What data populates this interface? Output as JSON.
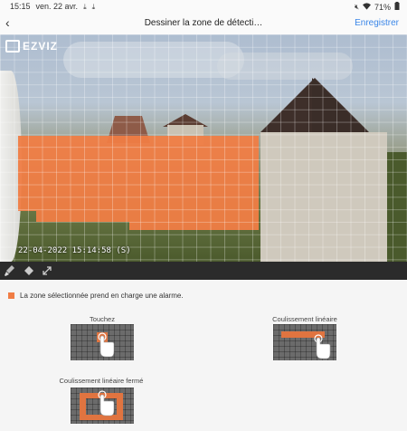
{
  "status_bar": {
    "time": "15:15",
    "date": "ven. 22 avr.",
    "battery": "71%",
    "icons": [
      "download-icon",
      "download-icon",
      "mute-icon",
      "wifi-icon",
      "battery-icon"
    ]
  },
  "header": {
    "back_icon": "chevron-left-icon",
    "title": "Dessiner la zone de détecti…",
    "save_label": "Enregistrer"
  },
  "camera": {
    "logo_text": "EZVIZ",
    "timestamp": "22-04-2022 15:14:58  (S)",
    "zone_color": "#f07d45"
  },
  "toolbar": {
    "tools": [
      "brush-icon",
      "eraser-icon",
      "fullscreen-icon"
    ]
  },
  "legend": {
    "text": "La zone sélectionnée prend en charge une alarme."
  },
  "demos": {
    "touch_label": "Touchez",
    "slide_label": "Coulissement linéaire",
    "closed_slide_label": "Coulissement linéaire fermé"
  },
  "colors": {
    "accent": "#3a86e8",
    "zone": "#f07d45",
    "toolbar_bg": "#2b2b2b"
  }
}
